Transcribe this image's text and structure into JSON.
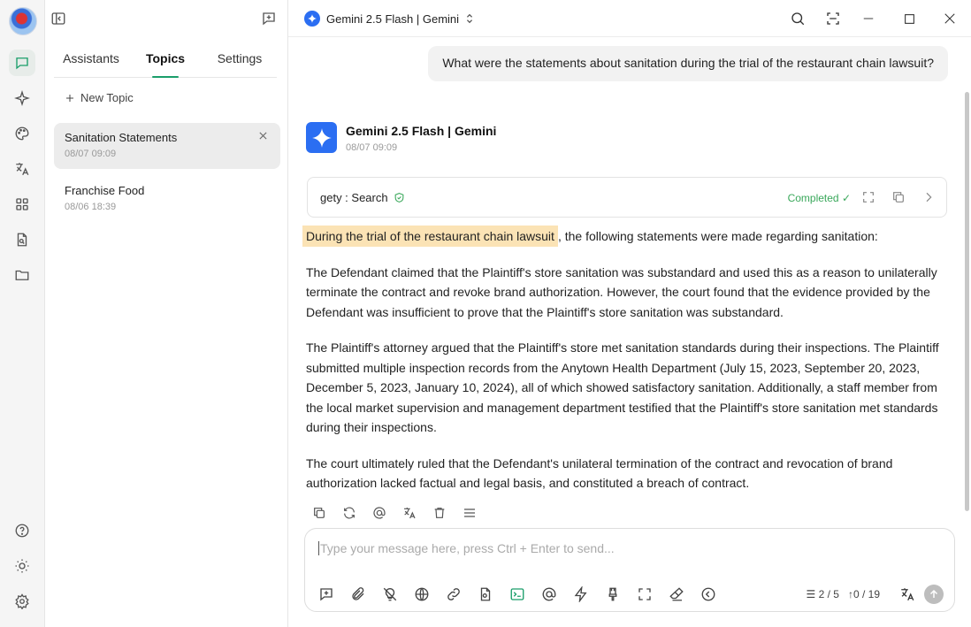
{
  "sidebar": {
    "tabs": [
      {
        "label": "Assistants"
      },
      {
        "label": "Topics"
      },
      {
        "label": "Settings"
      }
    ],
    "new_topic_label": "New Topic",
    "topics": [
      {
        "title": "Sanitation Statements",
        "date": "08/07 09:09"
      },
      {
        "title": "Franchise Food",
        "date": "08/06 18:39"
      }
    ]
  },
  "header": {
    "model_label": "Gemini 2.5 Flash | Gemini"
  },
  "chat": {
    "user_message": "What were the statements about sanitation during the trial of the restaurant chain lawsuit?",
    "assistant_name": "Gemini 2.5 Flash | Gemini",
    "assistant_date": "08/07 09:09",
    "tool": {
      "name": "gety : Search",
      "status": "Completed"
    },
    "answer_highlight": "During the trial of the restaurant chain lawsuit",
    "answer_intro_rest": ", the following statements were made regarding sanitation:",
    "answer_p1": "The Defendant claimed that the Plaintiff's store sanitation was substandard and used this as a reason to unilaterally terminate the contract and revoke brand authorization. However, the court found that the evidence provided by the Defendant was insufficient to prove that the Plaintiff's store sanitation was substandard.",
    "answer_p2": "The Plaintiff's attorney argued that the Plaintiff's store met sanitation standards during their inspections. The Plaintiff submitted multiple inspection records from the Anytown Health Department (July 15, 2023, September 20, 2023, December 5, 2023, January 10, 2024), all of which showed satisfactory sanitation. Additionally, a staff member from the local market supervision and management department testified that the Plaintiff's store sanitation met standards during their inspections.",
    "answer_p3": "The court ultimately ruled that the Defendant's unilateral termination of the contract and revocation of brand authorization lacked factual and legal basis, and constituted a breach of contract."
  },
  "composer": {
    "placeholder": "Type your message here, press Ctrl + Enter to send...",
    "context_count": "2 / 5",
    "token_count": "0 / 19"
  },
  "colors": {
    "accent": "#1a9e6a",
    "gemini_blue": "#2b6ef2",
    "highlight": "#fbe3b5",
    "status_green": "#3aa85b"
  }
}
